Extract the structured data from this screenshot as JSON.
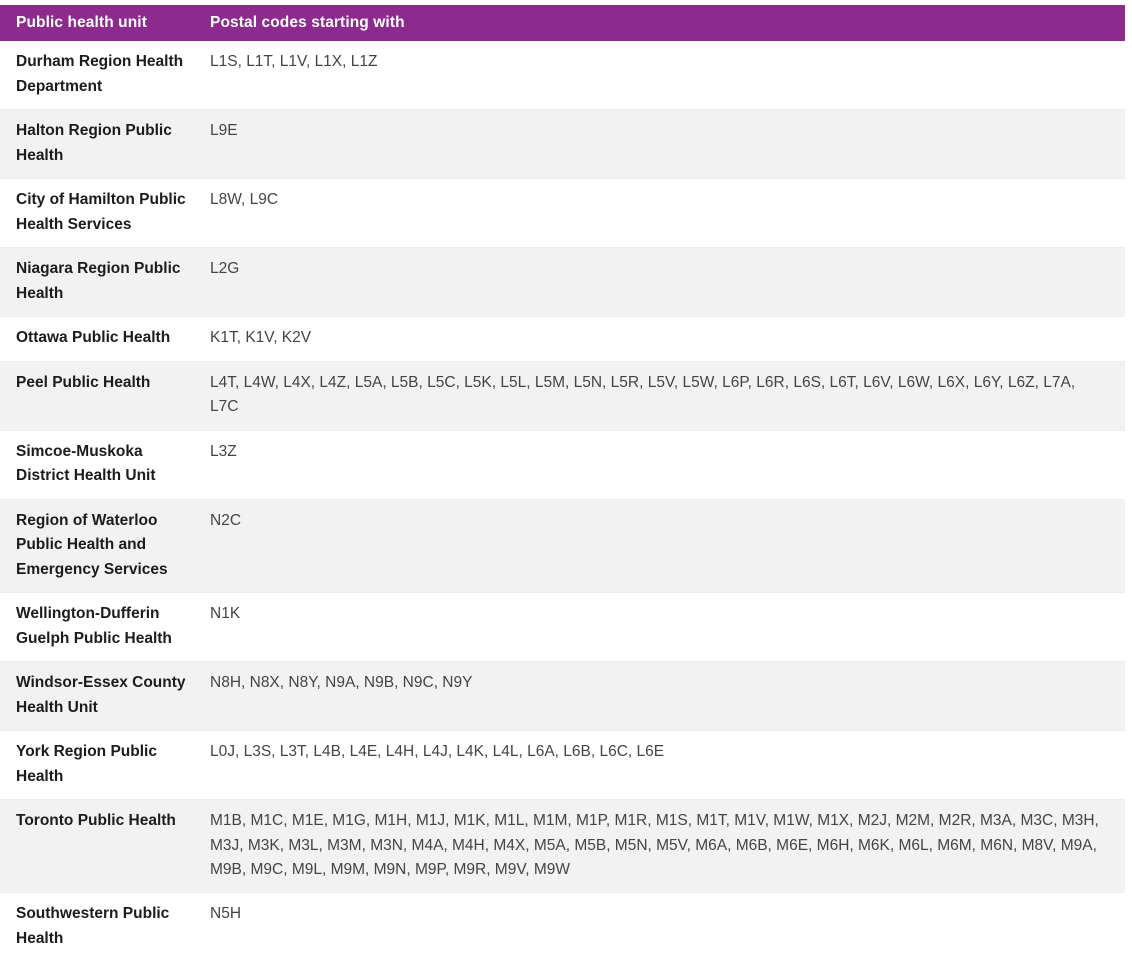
{
  "theme": {
    "header_background": "#8d2a8d",
    "header_text": "#ffffff",
    "row_background": "#ffffff",
    "row_background_alt": "#f2f2f2",
    "unit_text": "#1c1c1c",
    "codes_text": "#444444"
  },
  "table": {
    "columns": [
      {
        "key": "unit",
        "label": "Public health unit"
      },
      {
        "key": "codes",
        "label": "Postal codes starting with"
      }
    ],
    "rows": [
      {
        "unit": "Durham Region Health Department",
        "codes": "L1S, L1T, L1V, L1X, L1Z"
      },
      {
        "unit": "Halton Region Public Health",
        "codes": "L9E"
      },
      {
        "unit": "City of Hamilton Public Health Services",
        "codes": "L8W, L9C"
      },
      {
        "unit": "Niagara Region Public Health",
        "codes": "L2G"
      },
      {
        "unit": "Ottawa Public Health",
        "codes": "K1T, K1V, K2V"
      },
      {
        "unit": "Peel Public Health",
        "codes": "L4T, L4W, L4X, L4Z, L5A, L5B, L5C, L5K, L5L, L5M, L5N, L5R, L5V, L5W, L6P, L6R, L6S, L6T, L6V, L6W, L6X, L6Y, L6Z, L7A, L7C"
      },
      {
        "unit": "Simcoe-Muskoka District Health Unit",
        "codes": "L3Z"
      },
      {
        "unit": "Region of Waterloo Public Health and Emergency Services",
        "codes": "N2C"
      },
      {
        "unit": "Wellington-Dufferin Guelph Public Health",
        "codes": "N1K"
      },
      {
        "unit": "Windsor-Essex County Health Unit",
        "codes": "N8H, N8X, N8Y, N9A, N9B, N9C, N9Y"
      },
      {
        "unit": "York Region Public Health",
        "codes": "L0J, L3S, L3T, L4B, L4E, L4H, L4J, L4K, L4L, L6A, L6B, L6C, L6E"
      },
      {
        "unit": "Toronto Public Health",
        "codes": "M1B, M1C, M1E, M1G, M1H, M1J, M1K, M1L, M1M, M1P, M1R, M1S, M1T, M1V, M1W, M1X, M2J, M2M, M2R, M3A, M3C, M3H, M3J, M3K, M3L, M3M, M3N, M4A, M4H, M4X, M5A, M5B, M5N, M5V, M6A, M6B, M6E, M6H, M6K, M6L, M6M, M6N, M8V, M9A, M9B, M9C, M9L, M9M, M9N, M9P, M9R, M9V, M9W"
      },
      {
        "unit": "Southwestern Public Health",
        "codes": "N5H"
      }
    ]
  }
}
